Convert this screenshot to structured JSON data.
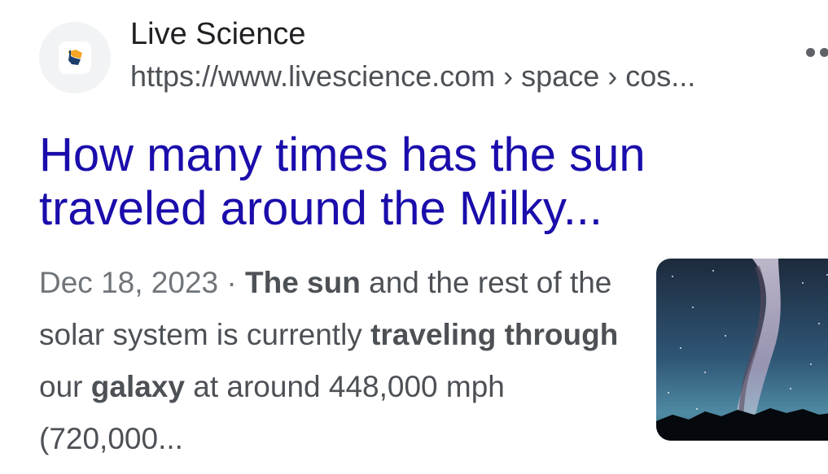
{
  "source": {
    "site_name": "Live Science",
    "url": "https://www.livescience.com › space › cos...",
    "favicon": "livescience-logo-icon"
  },
  "result": {
    "title": "How many times has the sun traveled around the Milky...",
    "date": "Dec 18, 2023",
    "separator": " · ",
    "snippet_parts": [
      {
        "text": "The sun",
        "bold": true
      },
      {
        "text": " and the rest of the solar system is currently ",
        "bold": false
      },
      {
        "text": "traveling through",
        "bold": true
      },
      {
        "text": " our ",
        "bold": false
      },
      {
        "text": "galaxy",
        "bold": true
      },
      {
        "text": " at around 448,000 mph (720,000...",
        "bold": false
      }
    ],
    "thumbnail": "milky-way-night-sky-image"
  },
  "more_options_icon": "more-dots-icon",
  "colors": {
    "title_link": "#1a0dab",
    "site_name": "#202124",
    "url": "#4d5156",
    "date": "#70757a",
    "favicon_bg": "#f1f3f4",
    "logo_orange": "#f5a623",
    "logo_navy": "#1c3f6e"
  }
}
